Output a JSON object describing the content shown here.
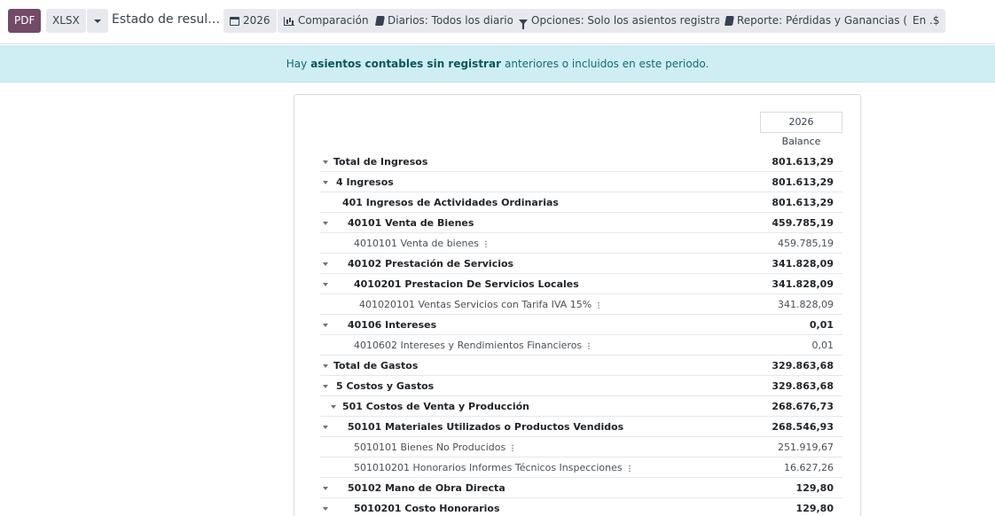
{
  "toolbar": {
    "pdf_label": "PDF",
    "xlsx_label": "XLSX",
    "report_title": "Estado de resul…",
    "year_label": "2026",
    "comparison_label": "Comparación",
    "journals_label": "Diarios: Todos los diarios",
    "options_label": "Opciones: Solo los asientos registrados",
    "report_label": "Reporte: Pérdidas y Ganancias (EC)",
    "currency_label": "En .$"
  },
  "alert": {
    "prefix": "Hay",
    "link": "asientos contables sin registrar",
    "suffix": "anteriores o incluidos en este periodo."
  },
  "report": {
    "column_period": "2026",
    "column_subtitle": "Balance",
    "rows": [
      {
        "label": "Total de Ingresos",
        "amount": "801.613,29",
        "bold": true,
        "expand": true,
        "level": 0
      },
      {
        "label": "4 Ingresos",
        "amount": "801.613,29",
        "bold": true,
        "expand": true,
        "level": 1
      },
      {
        "label": "401 Ingresos de Actividades Ordinarias",
        "amount": "801.613,29",
        "bold": true,
        "expand": false,
        "level": 2
      },
      {
        "label": "40101 Venta de Bienes",
        "amount": "459.785,19",
        "bold": true,
        "expand": true,
        "level": 3
      },
      {
        "label": "4010101 Venta de bienes",
        "amount": "459.785,19",
        "bold": false,
        "expand": false,
        "level": 4,
        "dots": true
      },
      {
        "label": "40102 Prestación de Servicios",
        "amount": "341.828,09",
        "bold": true,
        "expand": true,
        "level": 3
      },
      {
        "label": "4010201 Prestacion De Servicios Locales",
        "amount": "341.828,09",
        "bold": true,
        "expand": true,
        "level": 4
      },
      {
        "label": "401020101 Ventas Servicios con Tarifa IVA 15%",
        "amount": "341.828,09",
        "bold": false,
        "expand": false,
        "level": 5,
        "dots": true
      },
      {
        "label": "40106 Intereses",
        "amount": "0,01",
        "bold": true,
        "expand": true,
        "level": 3
      },
      {
        "label": "4010602 Intereses y Rendimientos Financieros",
        "amount": "0,01",
        "bold": false,
        "expand": false,
        "level": 4,
        "dots": true
      },
      {
        "label": "Total de Gastos",
        "amount": "329.863,68",
        "bold": true,
        "expand": true,
        "level": 0
      },
      {
        "label": "5 Costos y Gastos",
        "amount": "329.863,68",
        "bold": true,
        "expand": true,
        "level": 1
      },
      {
        "label": "501 Costos de Venta y Producción",
        "amount": "268.676,73",
        "bold": true,
        "expand": true,
        "level": 2
      },
      {
        "label": "50101 Materiales Utilizados o Productos Vendidos",
        "amount": "268.546,93",
        "bold": true,
        "expand": true,
        "level": 3
      },
      {
        "label": "5010101 Bienes No Producidos",
        "amount": "251.919,67",
        "bold": false,
        "expand": false,
        "level": 4,
        "dots": true
      },
      {
        "label": "501010201 Honorarios Informes Técnicos Inspecciones",
        "amount": "16.627,26",
        "bold": false,
        "expand": false,
        "level": 4,
        "dots": true
      },
      {
        "label": "50102 Mano de Obra Directa",
        "amount": "129,80",
        "bold": true,
        "expand": true,
        "level": 3
      },
      {
        "label": "5010201 Costo Honorarios",
        "amount": "129,80",
        "bold": true,
        "expand": true,
        "level": 4
      }
    ]
  }
}
